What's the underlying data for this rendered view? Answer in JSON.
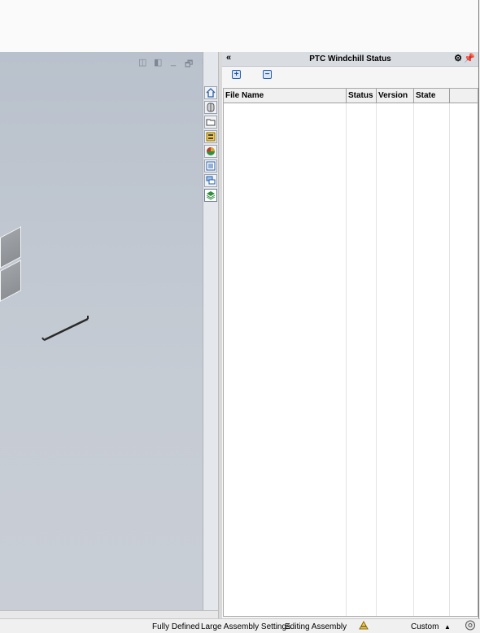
{
  "panel": {
    "collapse_label": "«",
    "title": "PTC Windchill Status",
    "gear_icon": "gear-icon",
    "pin_icon": "pin-icon",
    "expand_label": "+",
    "collapse_all_label": "−"
  },
  "table": {
    "columns": [
      "File Name",
      "Status",
      "Version",
      "State"
    ],
    "rows": []
  },
  "viewport": {
    "controls": [
      "◫",
      "◧",
      "_",
      "🗗",
      "×"
    ]
  },
  "task_tabs": [
    "home-icon",
    "3d-content-icon",
    "file-explorer-icon",
    "view-palette-icon",
    "appearances-icon",
    "custom-properties-icon",
    "forum-icon",
    "windchill-status-icon"
  ],
  "status_bar": {
    "definition": "Fully Defined",
    "large_assembly": "Large Assembly Settings",
    "mode": "Editing Assembly",
    "units": "Custom",
    "units_arrow": "▲"
  }
}
